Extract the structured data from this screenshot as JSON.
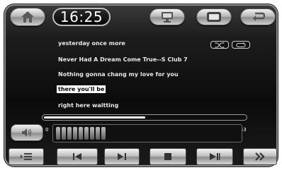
{
  "header": {
    "clock": "16:25"
  },
  "lyrics": {
    "lines": [
      "yesterday once more",
      "Never Had A Dream Come True--S Club 7",
      "Nothing gonna chang my love for you",
      "there you'll be",
      "right here waitting"
    ],
    "current_index": 3
  },
  "playback": {
    "elapsed": "0",
    "duration": "3:53",
    "progress_fraction": 0.5
  },
  "volume": {
    "level_segments": 9,
    "total_segments": 30
  },
  "icons": {
    "home": "home-icon",
    "monitor": "monitor-icon",
    "window": "window-icon",
    "back": "back-arrow-icon",
    "shuffle": "shuffle-icon",
    "repeat": "repeat-icon",
    "volume": "speaker-icon",
    "playlist": "playlist-icon",
    "previous": "previous-track-icon",
    "play_pause": "play-pause-icon",
    "stop": "stop-icon",
    "next": "next-track-icon",
    "more": "double-chevron-icon"
  },
  "colors": {
    "background": "#0b0b0b",
    "text": "#e8e8e8",
    "highlight": "#ffffff"
  }
}
